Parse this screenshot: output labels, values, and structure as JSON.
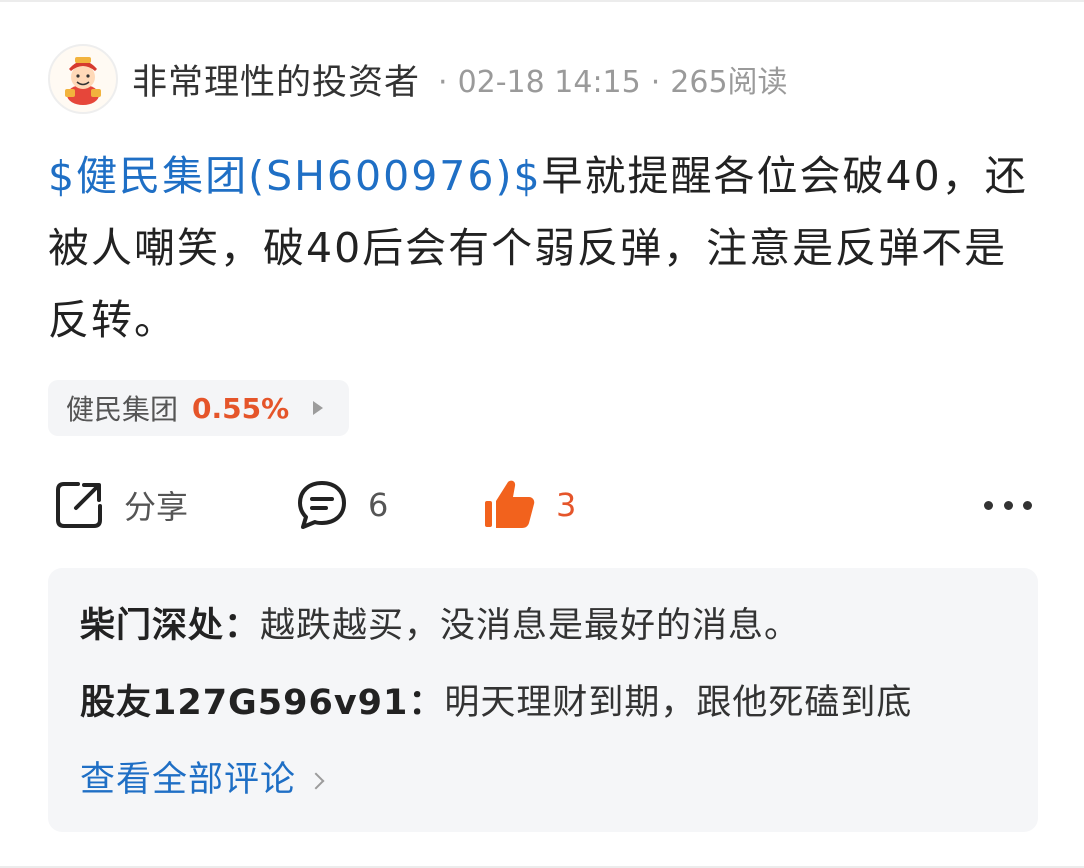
{
  "post": {
    "author": "非常理性的投资者",
    "date": "02-18 14:15",
    "reads": "265阅读",
    "stock_mention": "$健民集团(SH600976)$",
    "text": "早就提醒各位会破40，还被人嘲笑，破40后会有个弱反弹，注意是反弹不是反转。"
  },
  "stock_chip": {
    "name": "健民集团",
    "change": "0.55%"
  },
  "actions": {
    "share_label": "分享",
    "comment_count": "6",
    "like_count": "3"
  },
  "comments": [
    {
      "author": "柴门深处：",
      "text": "越跌越买，没消息是最好的消息。"
    },
    {
      "author": "股友127G596v91：",
      "text": "明天理财到期，跟他死磕到底"
    }
  ],
  "view_all_label": "查看全部评论",
  "colors": {
    "link_blue": "#1f6fc5",
    "accent_orange": "#e5552a",
    "comment_bg": "#f5f6f8"
  },
  "icons": {
    "avatar": "cartoon-fortune-god-avatar",
    "share": "share-icon",
    "comment": "comment-bubble-icon",
    "like": "thumbs-up-icon",
    "more": "more-dots-icon"
  }
}
